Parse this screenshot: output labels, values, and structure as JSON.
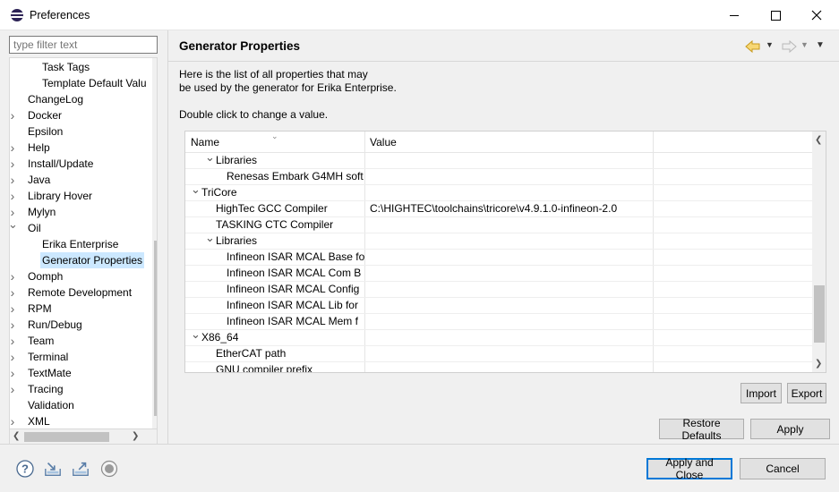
{
  "window": {
    "title": "Preferences",
    "controls": {
      "minimize": "minimize",
      "maximize": "maximize",
      "close": "close"
    }
  },
  "sidebar": {
    "filter_placeholder": "type filter text",
    "items": [
      {
        "label": "Task Tags",
        "level": 2,
        "expandable": false,
        "expanded": false,
        "selected": false
      },
      {
        "label": "Template Default Valu",
        "level": 2,
        "expandable": false,
        "expanded": false,
        "selected": false
      },
      {
        "label": "ChangeLog",
        "level": 1,
        "expandable": false,
        "expanded": false,
        "selected": false
      },
      {
        "label": "Docker",
        "level": 1,
        "expandable": true,
        "expanded": false,
        "selected": false
      },
      {
        "label": "Epsilon",
        "level": 1,
        "expandable": false,
        "expanded": false,
        "selected": false
      },
      {
        "label": "Help",
        "level": 1,
        "expandable": true,
        "expanded": false,
        "selected": false
      },
      {
        "label": "Install/Update",
        "level": 1,
        "expandable": true,
        "expanded": false,
        "selected": false
      },
      {
        "label": "Java",
        "level": 1,
        "expandable": true,
        "expanded": false,
        "selected": false
      },
      {
        "label": "Library Hover",
        "level": 1,
        "expandable": true,
        "expanded": false,
        "selected": false
      },
      {
        "label": "Mylyn",
        "level": 1,
        "expandable": true,
        "expanded": false,
        "selected": false
      },
      {
        "label": "Oil",
        "level": 1,
        "expandable": true,
        "expanded": true,
        "selected": false
      },
      {
        "label": "Erika Enterprise",
        "level": 2,
        "expandable": false,
        "expanded": false,
        "selected": false
      },
      {
        "label": "Generator Properties",
        "level": 2,
        "expandable": false,
        "expanded": false,
        "selected": true
      },
      {
        "label": "Oomph",
        "level": 1,
        "expandable": true,
        "expanded": false,
        "selected": false
      },
      {
        "label": "Remote Development",
        "level": 1,
        "expandable": true,
        "expanded": false,
        "selected": false
      },
      {
        "label": "RPM",
        "level": 1,
        "expandable": true,
        "expanded": false,
        "selected": false
      },
      {
        "label": "Run/Debug",
        "level": 1,
        "expandable": true,
        "expanded": false,
        "selected": false
      },
      {
        "label": "Team",
        "level": 1,
        "expandable": true,
        "expanded": false,
        "selected": false
      },
      {
        "label": "Terminal",
        "level": 1,
        "expandable": true,
        "expanded": false,
        "selected": false
      },
      {
        "label": "TextMate",
        "level": 1,
        "expandable": true,
        "expanded": false,
        "selected": false
      },
      {
        "label": "Tracing",
        "level": 1,
        "expandable": true,
        "expanded": false,
        "selected": false
      },
      {
        "label": "Validation",
        "level": 1,
        "expandable": false,
        "expanded": false,
        "selected": false
      },
      {
        "label": "XML",
        "level": 1,
        "expandable": true,
        "expanded": false,
        "selected": false
      }
    ]
  },
  "page": {
    "title": "Generator Properties",
    "description_line1": "Here is the list of all properties that may",
    "description_line2": "be used by the generator for Erika Enterprise.",
    "hint": "Double click to change a value.",
    "nav": {
      "back": "back-arrow",
      "forward": "forward-arrow",
      "menu": "view-menu"
    }
  },
  "table": {
    "columns": [
      "Name",
      "Value",
      ""
    ],
    "rows": [
      {
        "name": "Libraries",
        "value": "",
        "level": 1,
        "expandable": true
      },
      {
        "name": "Renesas Embark G4MH soft",
        "value": "",
        "level": 2,
        "expandable": false
      },
      {
        "name": "TriCore",
        "value": "",
        "level": 0,
        "expandable": true
      },
      {
        "name": "HighTec GCC Compiler",
        "value": "C:\\HIGHTEC\\toolchains\\tricore\\v4.9.1.0-infineon-2.0",
        "level": 1,
        "expandable": false
      },
      {
        "name": "TASKING CTC Compiler",
        "value": "",
        "level": 1,
        "expandable": false
      },
      {
        "name": "Libraries",
        "value": "",
        "level": 1,
        "expandable": true
      },
      {
        "name": "Infineon ISAR MCAL Base fo",
        "value": "",
        "level": 2,
        "expandable": false
      },
      {
        "name": "Infineon ISAR MCAL Com B",
        "value": "",
        "level": 2,
        "expandable": false
      },
      {
        "name": "Infineon ISAR MCAL Config",
        "value": "",
        "level": 2,
        "expandable": false
      },
      {
        "name": "Infineon ISAR MCAL Lib for",
        "value": "",
        "level": 2,
        "expandable": false
      },
      {
        "name": "Infineon ISAR MCAL Mem f",
        "value": "",
        "level": 2,
        "expandable": false
      },
      {
        "name": "X86_64",
        "value": "",
        "level": 0,
        "expandable": true
      },
      {
        "name": "EtherCAT path",
        "value": "",
        "level": 1,
        "expandable": false
      },
      {
        "name": "GNU compiler prefix",
        "value": "",
        "level": 1,
        "expandable": false
      }
    ]
  },
  "buttons": {
    "import": "Import",
    "export": "Export",
    "restore_defaults": "Restore Defaults",
    "apply": "Apply",
    "apply_and_close": "Apply and Close",
    "cancel": "Cancel"
  },
  "bottom_icons": [
    "help-icon",
    "import-preferences-icon",
    "export-preferences-icon",
    "record-icon"
  ]
}
